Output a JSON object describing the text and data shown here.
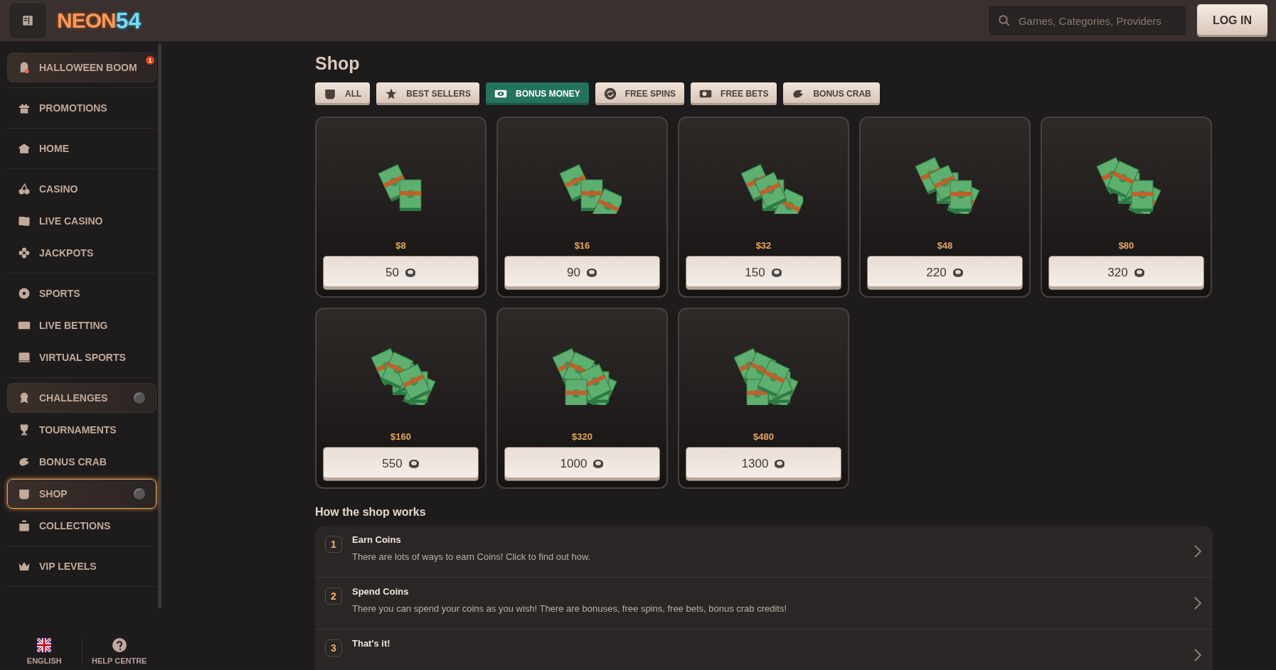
{
  "header": {
    "logo": {
      "word": "NEON",
      "number": "54"
    },
    "search": {
      "placeholder": "Games, Categories, Providers"
    },
    "login_button": "LOG IN"
  },
  "sidebar": {
    "groups": [
      [
        {
          "label": "HALLOWEEN BOOM",
          "kind": "featured",
          "selected": false,
          "badge": "1"
        }
      ],
      [
        {
          "label": "PROMOTIONS",
          "kind": "plain",
          "selected": false
        }
      ],
      [
        {
          "label": "HOME",
          "kind": "plain",
          "selected": false
        }
      ],
      [
        {
          "label": "CASINO",
          "kind": "plain",
          "selected": false
        },
        {
          "label": "LIVE CASINO",
          "kind": "plain",
          "selected": false
        },
        {
          "label": "JACKPOTS",
          "kind": "plain",
          "selected": false
        }
      ],
      [
        {
          "label": "SPORTS",
          "kind": "plain",
          "selected": false
        },
        {
          "label": "LIVE BETTING",
          "kind": "plain",
          "selected": false
        },
        {
          "label": "VIRTUAL SPORTS",
          "kind": "plain",
          "selected": false
        }
      ],
      [
        {
          "label": "CHALLENGES",
          "kind": "featured",
          "selected": false,
          "toggle": true
        },
        {
          "label": "TOURNAMENTS",
          "kind": "plain",
          "selected": false
        },
        {
          "label": "BONUS CRAB",
          "kind": "plain",
          "selected": false
        },
        {
          "label": "SHOP",
          "kind": "plain",
          "selected": true,
          "toggle": true
        },
        {
          "label": "COLLECTIONS",
          "kind": "plain",
          "selected": false
        }
      ],
      [
        {
          "label": "VIP LEVELS",
          "kind": "plain",
          "selected": false
        }
      ]
    ],
    "footer": [
      {
        "label": "ENGLISH"
      },
      {
        "label": "HELP CENTRE"
      }
    ]
  },
  "shop": {
    "title": "Shop",
    "tabs": [
      {
        "label": "ALL",
        "selected": false
      },
      {
        "label": "BEST SELLERS",
        "selected": false
      },
      {
        "label": "BONUS MONEY",
        "selected": true
      },
      {
        "label": "FREE SPINS",
        "selected": false
      },
      {
        "label": "FREE BETS",
        "selected": false
      },
      {
        "label": "BONUS CRAB",
        "selected": false
      }
    ],
    "items": [
      {
        "price": "$8",
        "coins": "50"
      },
      {
        "price": "$16",
        "coins": "90"
      },
      {
        "price": "$32",
        "coins": "150"
      },
      {
        "price": "$48",
        "coins": "220"
      },
      {
        "price": "$80",
        "coins": "320"
      },
      {
        "price": "$160",
        "coins": "550"
      },
      {
        "price": "$320",
        "coins": "1000"
      },
      {
        "price": "$480",
        "coins": "1300"
      }
    ]
  },
  "how_it_works": {
    "title": "How the shop works",
    "steps": [
      {
        "number": "1",
        "title": "Earn Coins",
        "description": "There are lots of ways to earn Coins! Click to find out how."
      },
      {
        "number": "2",
        "title": "Spend Coins",
        "description": "There you can spend your coins as you wish! There are bonuses, free spins, free bets, bonus crab credits!"
      },
      {
        "number": "3",
        "title": "That's it!"
      }
    ]
  }
}
